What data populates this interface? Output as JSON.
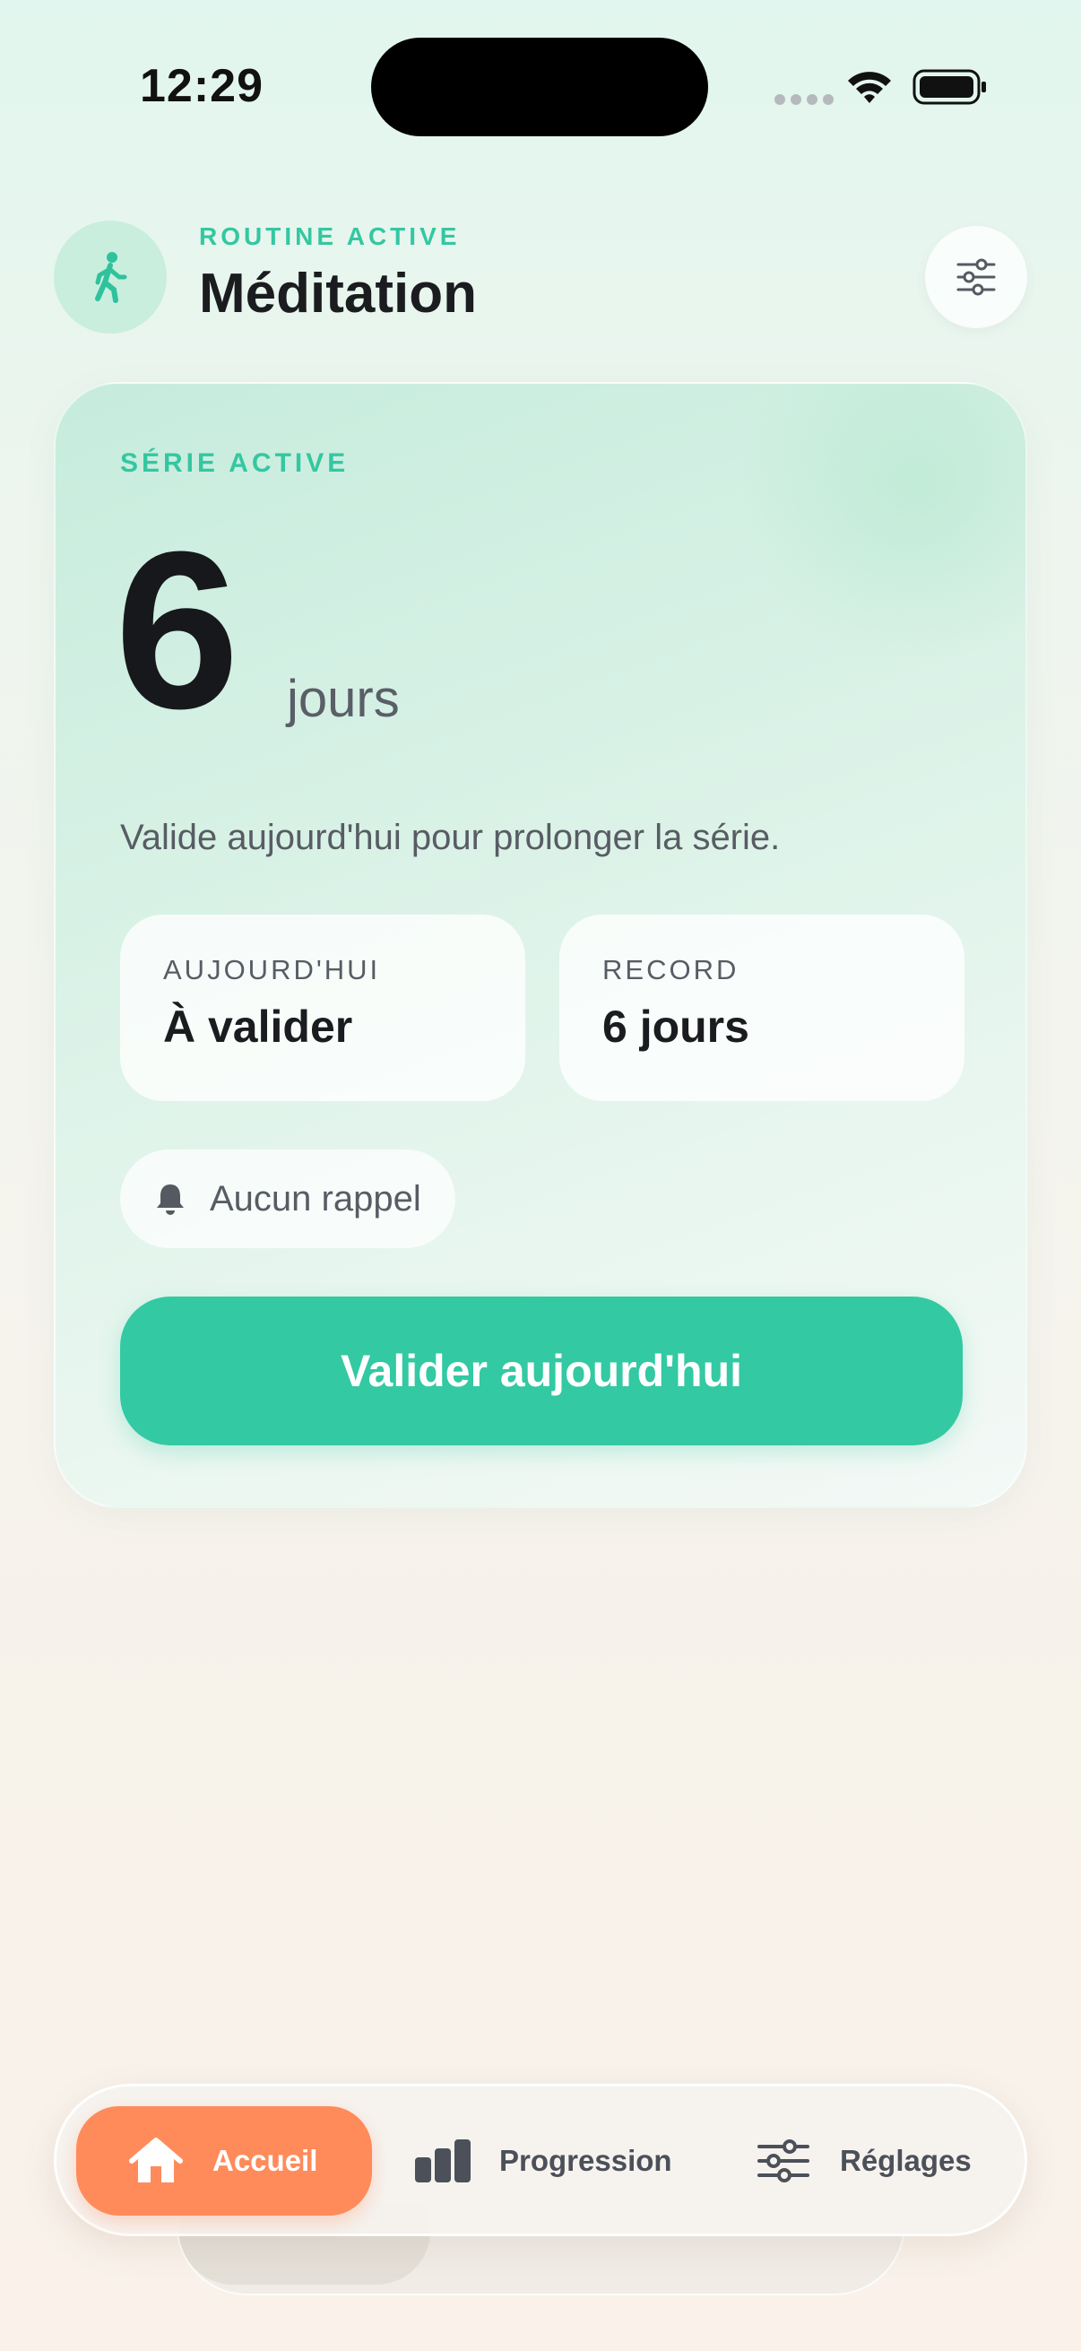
{
  "status_bar": {
    "time": "12:29"
  },
  "header": {
    "eyebrow": "ROUTINE ACTIVE",
    "title": "Méditation",
    "routine_icon": "walking-person-icon",
    "settings_icon": "sliders-icon"
  },
  "card": {
    "eyebrow": "SÉRIE ACTIVE",
    "streak_value": "6",
    "streak_unit": "jours",
    "message": "Valide aujourd'hui pour prolonger la série.",
    "stats": [
      {
        "label": "AUJOURD'HUI",
        "value": "À valider"
      },
      {
        "label": "RECORD",
        "value": "6 jours"
      }
    ],
    "reminder": {
      "icon": "bell-icon",
      "label": "Aucun rappel"
    },
    "validate_label": "Valider aujourd'hui"
  },
  "tabs": [
    {
      "label": "Accueil",
      "icon": "home-icon",
      "active": true
    },
    {
      "label": "Progression",
      "icon": "bar-chart-icon",
      "active": false
    },
    {
      "label": "Réglages",
      "icon": "sliders-icon",
      "active": false
    }
  ],
  "colors": {
    "accent": "#33c9a2",
    "accent_text": "#34c7a1",
    "active_tab": "#ff8b5b",
    "text_primary": "#1b1c1f",
    "text_secondary": "#585c64"
  }
}
